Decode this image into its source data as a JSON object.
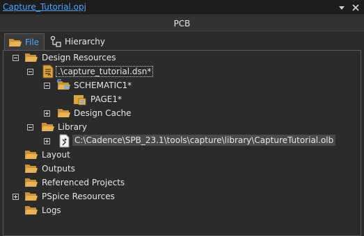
{
  "window": {
    "title": "Capture_Tutorial.opj",
    "pin_icon": "pin-dropdown-icon",
    "close_icon": "close-icon"
  },
  "header": {
    "title": "PCB"
  },
  "tabs": [
    {
      "label": "File",
      "icon": "folder-icon",
      "active": true
    },
    {
      "label": "Hierarchy",
      "icon": "hierarchy-icon",
      "active": false
    }
  ],
  "tree": {
    "design_resources": "Design Resources",
    "design_file": ".\\capture_tutorial.dsn*",
    "schematic": "SCHEMATIC1*",
    "page": "PAGE1*",
    "design_cache": "Design Cache",
    "library": "Library",
    "library_file": "C:\\Cadence\\SPB_23.1\\tools\\capture\\library\\CaptureTutorial.olb",
    "layout": "Layout",
    "outputs": "Outputs",
    "referenced_projects": "Referenced Projects",
    "pspice_resources": "PSpice Resources",
    "logs": "Logs"
  },
  "colors": {
    "accent": "#4da6ff",
    "folder": "#d9a441",
    "background": "#2b2b2b"
  }
}
